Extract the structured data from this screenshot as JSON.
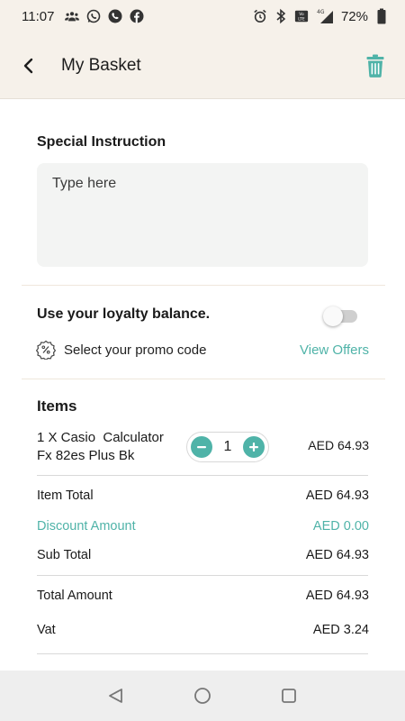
{
  "status_bar": {
    "time": "11:07",
    "battery": "72%",
    "icons_left": [
      "group-icon",
      "whatsapp-icon",
      "phone-icon",
      "facebook-icon"
    ],
    "icons_right": [
      "alarm-icon",
      "bluetooth-icon",
      "volte-icon",
      "signal-icon",
      "battery-icon"
    ]
  },
  "header": {
    "title": "My Basket",
    "back_icon": "back-arrow-icon",
    "trash_icon": "trash-icon"
  },
  "special_instruction": {
    "title": "Special Instruction",
    "placeholder": "Type here",
    "value": ""
  },
  "loyalty": {
    "label": "Use your loyalty balance.",
    "enabled": false
  },
  "promo": {
    "label": "Select your promo code",
    "action": "View Offers",
    "icon": "discount-badge-icon"
  },
  "items": {
    "title": "Items",
    "list": [
      {
        "name_line1": "1 X Casio  Calculator",
        "name_line2": "Fx 82es Plus Bk",
        "quantity": "1",
        "price": "AED 64.93"
      }
    ]
  },
  "summary": {
    "item_total_label": "Item Total",
    "item_total_value": "AED 64.93",
    "discount_label": "Discount Amount",
    "discount_value": "AED 0.00",
    "sub_total_label": "Sub Total",
    "sub_total_value": "AED 64.93",
    "total_amount_label": "Total Amount",
    "total_amount_value": "AED 64.93",
    "vat_label": "Vat",
    "vat_value": "AED 3.24"
  },
  "colors": {
    "accent": "#4fb3a8",
    "header_bg": "#f6f1ea"
  },
  "nav": {
    "back": "nav-back-icon",
    "home": "nav-home-icon",
    "recents": "nav-recents-icon"
  }
}
